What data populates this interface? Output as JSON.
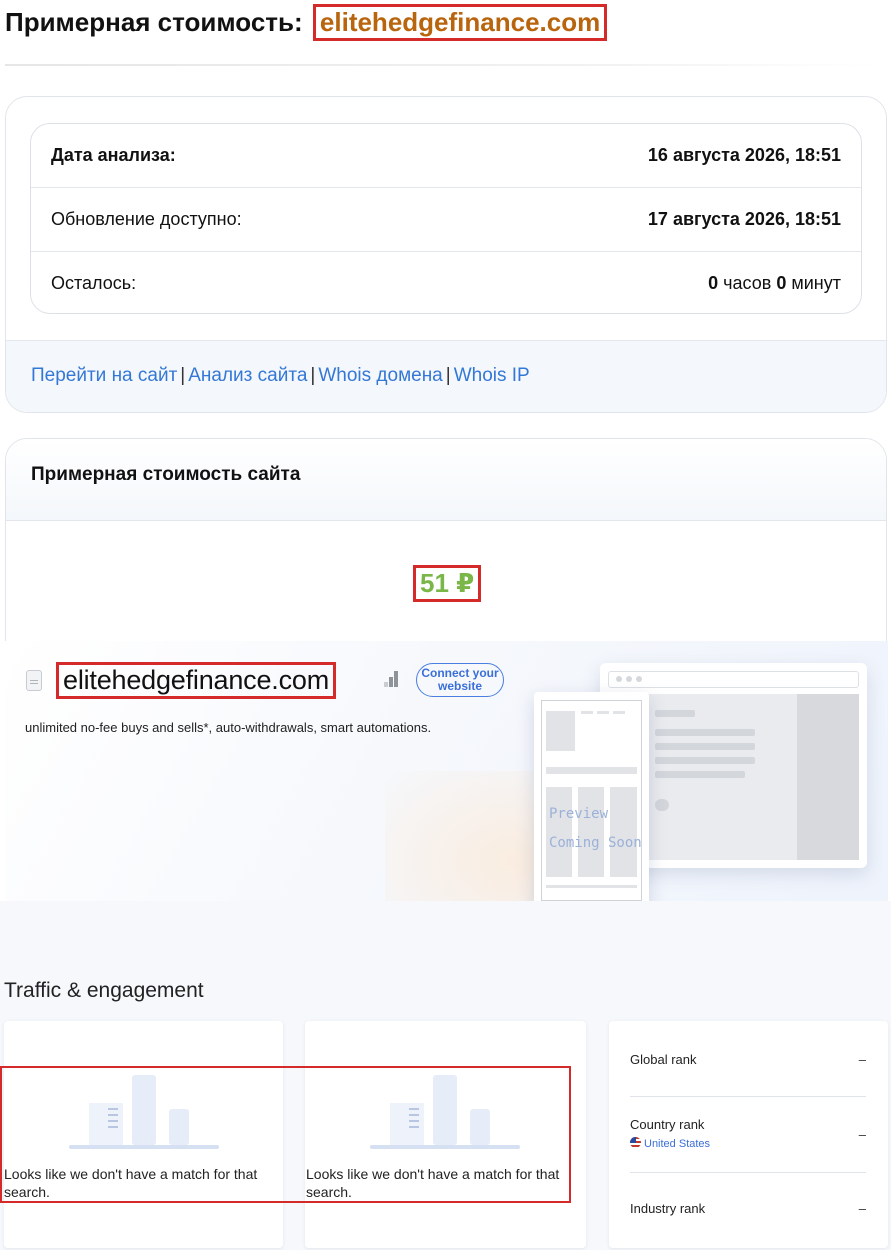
{
  "header": {
    "title_prefix": "Примерная стоимость:",
    "domain": "elitehedgefinance.com"
  },
  "analysis": {
    "rows": [
      {
        "label": "Дата анализа:",
        "value": "16 августа 2026, 18:51"
      },
      {
        "label": "Обновление доступно:",
        "value": "17 августа 2026, 18:51"
      },
      {
        "label": "Осталось:",
        "hours": "0",
        "hours_unit": "часов",
        "minutes": "0",
        "minutes_unit": "минут"
      }
    ],
    "links": [
      {
        "label": "Перейти на сайт"
      },
      {
        "label": "Анализ сайта"
      },
      {
        "label": "Whois домена"
      },
      {
        "label": "Whois IP"
      }
    ],
    "separator": "|"
  },
  "site_value": {
    "title": "Примерная стоимость сайта",
    "amount": "51 ₽"
  },
  "preview": {
    "domain": "elitehedgefinance.com",
    "connect_label": "Connect your website",
    "tagline": "unlimited no-fee buys and sells*, auto-withdrawals, smart automations.",
    "preview_line1": "Preview",
    "preview_line2": "Coming Soon"
  },
  "traffic": {
    "title": "Traffic & engagement",
    "no_match_1": "Looks like we don't have a match for that search.",
    "no_match_2": "Looks like we don't have a match for that search.",
    "ranks": [
      {
        "label": "Global rank",
        "value": "–"
      },
      {
        "label": "Country rank",
        "value": "–",
        "country": "United States"
      },
      {
        "label": "Industry rank",
        "value": "–"
      }
    ]
  },
  "colors": {
    "domain_orange": "#b8650e",
    "link_blue": "#3478d6",
    "value_green": "#7ab648",
    "highlight_red": "#d42a2a"
  }
}
